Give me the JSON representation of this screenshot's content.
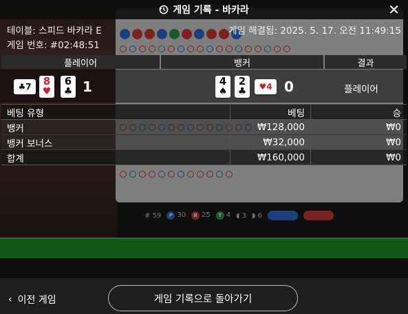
{
  "header": {
    "title": "게임 기록 - 바카라",
    "icon": "history-icon"
  },
  "info": {
    "table": "테이블: 스피드 바카라 E",
    "game_number": "게임 번호: #02:48:51",
    "resolved": "게임 해결됨: 2025. 5. 17. 오전 11:49:15"
  },
  "columns": {
    "player": "플레이어",
    "banker": "뱅커",
    "result": "결과"
  },
  "player": {
    "cards": [
      {
        "rank": "7",
        "suit": "♣",
        "color": "black",
        "side": true
      },
      {
        "rank": "8",
        "suit": "♥",
        "color": "red"
      },
      {
        "rank": "6",
        "suit": "♣",
        "color": "black"
      }
    ],
    "score": "1"
  },
  "banker": {
    "cards": [
      {
        "rank": "4",
        "suit": "♠",
        "color": "black"
      },
      {
        "rank": "2",
        "suit": "♣",
        "color": "black"
      },
      {
        "rank": "4",
        "suit": "♥",
        "color": "red",
        "side": true
      }
    ],
    "score": "0"
  },
  "result": "플레이어",
  "bets": {
    "headers": {
      "type": "베팅 유형",
      "bet": "베팅",
      "win": "승"
    },
    "rows": [
      {
        "type": "뱅커",
        "bet": "₩128,000",
        "win": "₩0"
      },
      {
        "type": "뱅커 보너스",
        "bet": "₩32,000",
        "win": "₩0"
      }
    ],
    "total": {
      "type": "합계",
      "bet": "₩160,000",
      "win": "₩0"
    }
  },
  "stats": {
    "games": "59",
    "player": "30",
    "banker": "25",
    "tie": "4",
    "other1": "3",
    "other2": "6",
    "labels": {
      "games": "#",
      "player": "P",
      "banker": "B",
      "tie": "T"
    }
  },
  "footer": {
    "prev": "이전 게임",
    "back": "게임 기록으로 돌아가기"
  },
  "colors": {
    "player_blue": "#2f6fd6",
    "banker_red": "#d23b3b",
    "tie_green": "#2e9a4a",
    "band_green": "#1f9a25"
  }
}
